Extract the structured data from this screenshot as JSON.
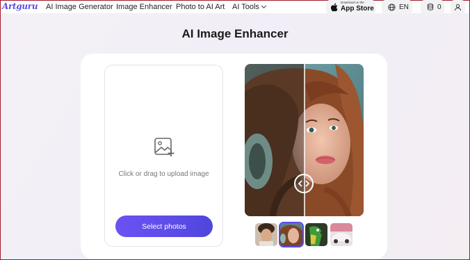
{
  "nav": {
    "logo": "Artguru",
    "links": [
      "AI Image Generator",
      "Image Enhancer",
      "Photo to AI Art",
      "AI Tools"
    ],
    "app_store_small": "Download on the",
    "app_store_big": "App Store",
    "language": "EN",
    "credits": "0"
  },
  "page": {
    "title": "AI Image Enhancer"
  },
  "upload": {
    "hint": "Click or drag to upload image",
    "button_label": "Select photos"
  },
  "thumbnails": [
    {
      "name": "man-with-curly-hair",
      "selected": false
    },
    {
      "name": "woman-with-headphones",
      "selected": true
    },
    {
      "name": "parrot",
      "selected": false
    },
    {
      "name": "white-car",
      "selected": false
    }
  ],
  "colors": {
    "accent": "#5c4ce8",
    "border_frame": "#a11a2a"
  },
  "icons": {
    "globe": "globe-icon",
    "coin": "coin-stack-icon",
    "user": "user-icon",
    "apple": "apple-icon",
    "image_add": "image-add-icon",
    "compare": "compare-arrows-icon"
  }
}
